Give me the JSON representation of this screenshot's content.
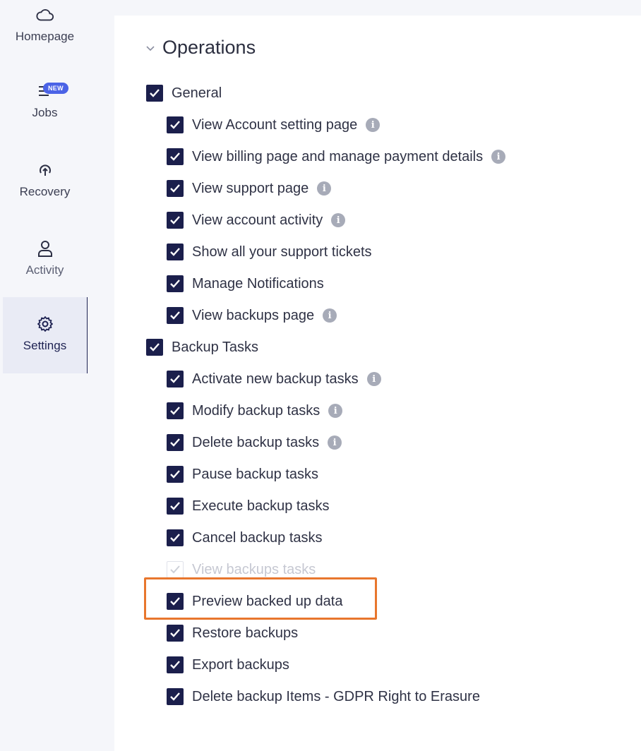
{
  "sidebar": {
    "items": [
      {
        "label": "Homepage",
        "icon": "cloud-icon"
      },
      {
        "label": "Jobs",
        "icon": "jobs-list-icon",
        "badge": "NEW"
      },
      {
        "label": "Recovery",
        "icon": "recovery-icon"
      },
      {
        "label": "Activity",
        "icon": "user-icon"
      },
      {
        "label": "Settings",
        "icon": "gear-icon",
        "active": true
      }
    ]
  },
  "section": {
    "title": "Operations",
    "groups": [
      {
        "label": "General",
        "checked": true,
        "items": [
          {
            "label": "View Account setting page",
            "checked": true,
            "info": true
          },
          {
            "label": "View billing page and manage payment details",
            "checked": true,
            "info": true
          },
          {
            "label": "View support page",
            "checked": true,
            "info": true
          },
          {
            "label": "View account activity",
            "checked": true,
            "info": true
          },
          {
            "label": "Show all your support tickets",
            "checked": true,
            "info": false
          },
          {
            "label": "Manage Notifications",
            "checked": true,
            "info": false
          },
          {
            "label": "View backups page",
            "checked": true,
            "info": true
          }
        ]
      },
      {
        "label": "Backup Tasks",
        "checked": true,
        "items": [
          {
            "label": "Activate new backup tasks",
            "checked": true,
            "info": true
          },
          {
            "label": "Modify backup tasks",
            "checked": true,
            "info": true
          },
          {
            "label": "Delete backup tasks",
            "checked": true,
            "info": true
          },
          {
            "label": "Pause backup tasks",
            "checked": true,
            "info": false
          },
          {
            "label": "Execute backup tasks",
            "checked": true,
            "info": false
          },
          {
            "label": "Cancel backup tasks",
            "checked": true,
            "info": false
          },
          {
            "label": "View backups tasks",
            "checked": true,
            "disabled": true,
            "info": false
          },
          {
            "label": "Preview backed up data",
            "checked": true,
            "info": false,
            "highlighted": true
          },
          {
            "label": "Restore backups",
            "checked": true,
            "info": false
          },
          {
            "label": "Export backups",
            "checked": true,
            "info": false
          },
          {
            "label": "Delete backup Items - GDPR Right to Erasure",
            "checked": true,
            "info": false
          }
        ]
      }
    ]
  },
  "colors": {
    "checkbox": "#1b1f4c",
    "highlight": "#e8762d",
    "badge": "#4b63e6",
    "info": "#a7abb8"
  }
}
